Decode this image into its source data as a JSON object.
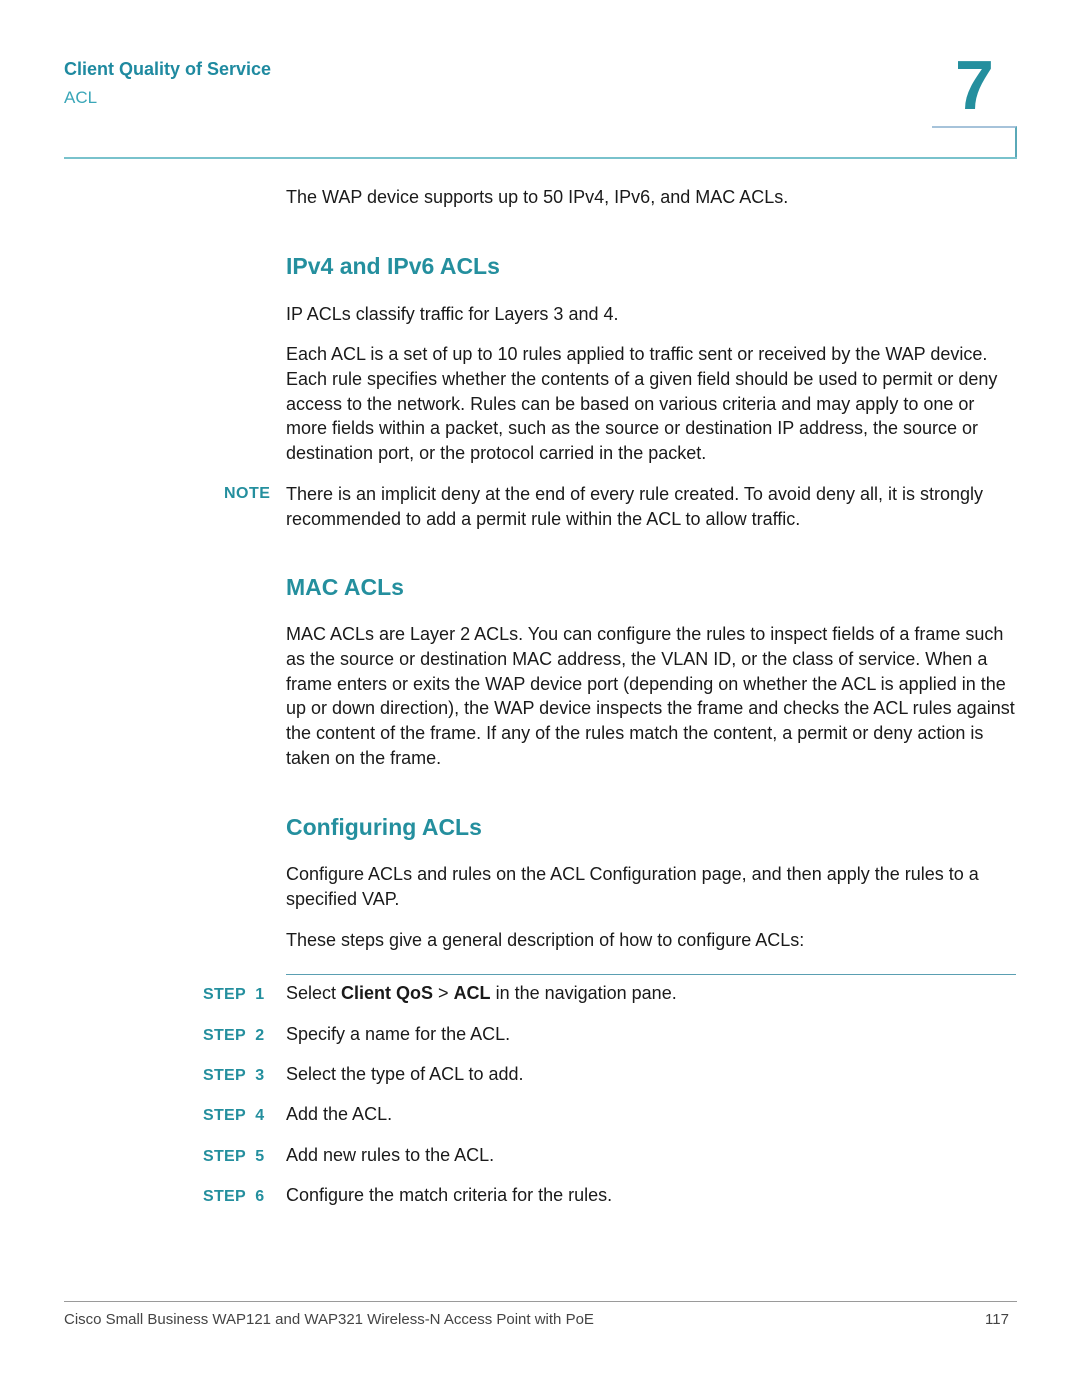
{
  "header": {
    "chapter_title": "Client Quality of Service",
    "section": "ACL",
    "chapter_number": "7"
  },
  "intro": "The WAP device supports up to 50 IPv4, IPv6, and MAC ACLs.",
  "sections": [
    {
      "heading": "IPv4 and IPv6 ACLs",
      "paragraphs": [
        "IP ACLs classify traffic for Layers 3 and 4.",
        "Each ACL is a set of up to 10 rules applied to traffic sent or received by the WAP device. Each rule specifies whether the contents of a given field should be used to permit or deny access to the network. Rules can be based on various criteria and may apply to one or more fields within a packet, such as the source or destination IP address, the source or destination port, or the protocol carried in the packet."
      ],
      "note": {
        "label": "NOTE",
        "text": "There is an implicit deny at the end of every rule created. To avoid deny all, it is strongly recommended to add a permit rule within the ACL to allow traffic."
      }
    },
    {
      "heading": "MAC ACLs",
      "paragraphs": [
        "MAC ACLs are Layer 2 ACLs. You can configure the rules to inspect fields of a frame such as the source or destination MAC address, the VLAN ID, or the class of service. When a frame enters or exits the WAP device port (depending on whether the ACL is applied in the up or down direction), the WAP device inspects the frame and checks the ACL rules against the content of the frame. If any of the rules match the content, a permit or deny action is taken on the frame."
      ]
    },
    {
      "heading": "Configuring ACLs",
      "paragraphs": [
        "Configure ACLs and rules on the ACL Configuration page, and then apply the rules to a specified VAP.",
        "These steps give a general description of how to configure ACLs:"
      ]
    }
  ],
  "steps": [
    {
      "label": "STEP  1",
      "pre": "Select ",
      "bold1": "Client QoS",
      "mid": " > ",
      "bold2": "ACL",
      "post": " in the navigation pane."
    },
    {
      "label": "STEP  2",
      "text": "Specify a name for the ACL."
    },
    {
      "label": "STEP  3",
      "text": "Select the type of ACL to add."
    },
    {
      "label": "STEP  4",
      "text": "Add the ACL."
    },
    {
      "label": "STEP  5",
      "text": "Add new rules to the ACL."
    },
    {
      "label": "STEP  6",
      "text": "Configure the match criteria for the rules."
    }
  ],
  "footer": {
    "title": "Cisco Small Business WAP121 and WAP321 Wireless-N Access Point with PoE",
    "page_number": "117"
  }
}
